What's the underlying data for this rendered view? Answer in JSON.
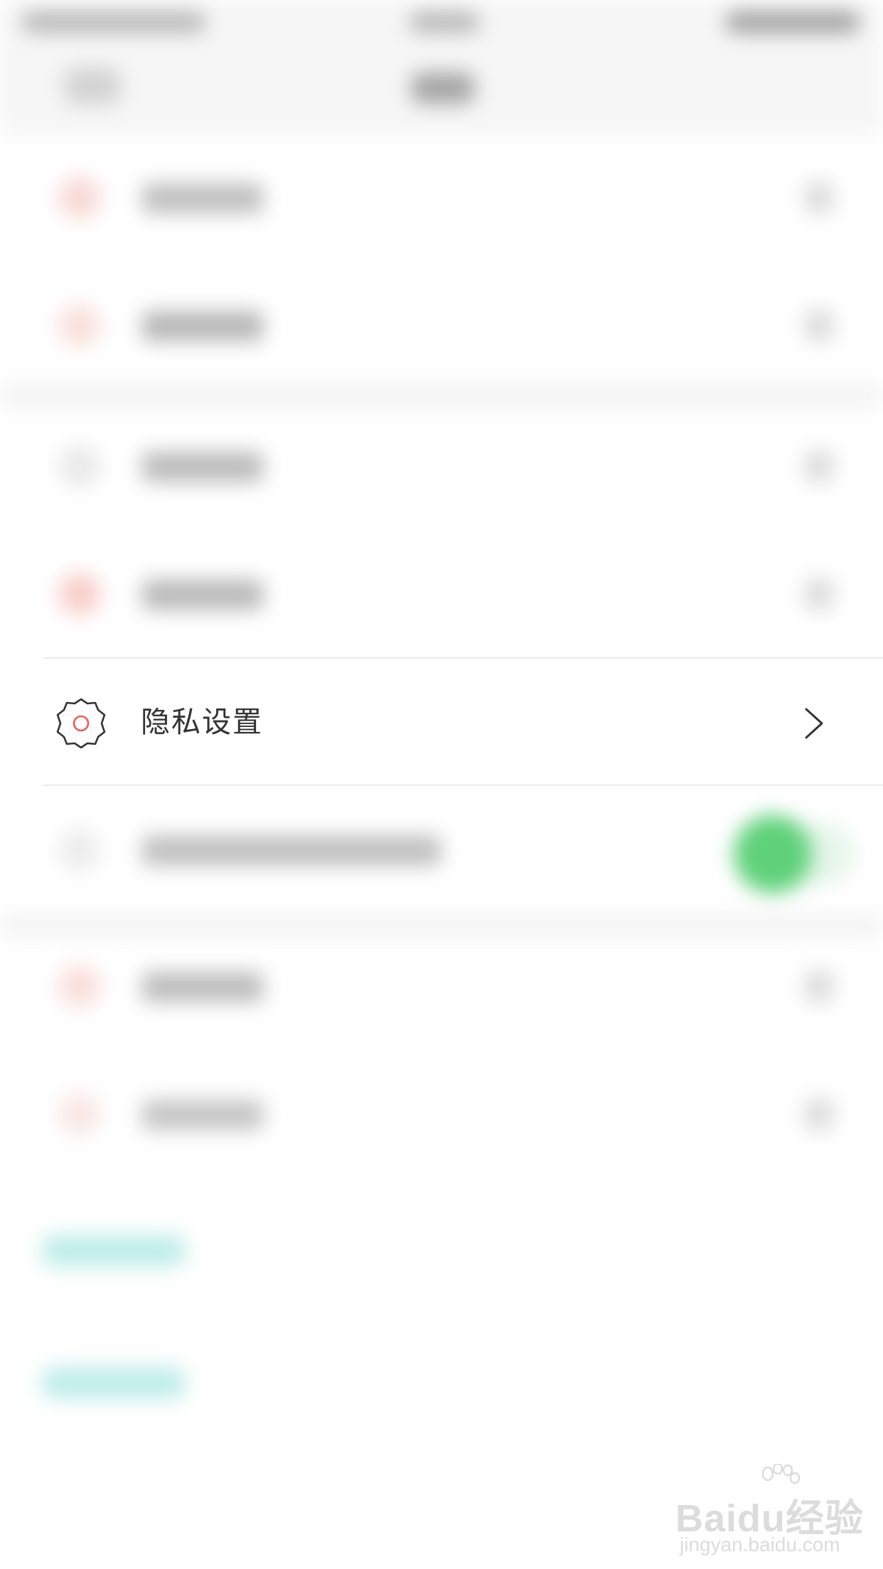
{
  "privacy_settings": {
    "label": "隐私设置",
    "icon": "gear-icon",
    "chevron_icon": "chevron-right-icon",
    "icon_accent_color": "#f05a5a",
    "icon_stroke_color": "#333333"
  },
  "watermark": {
    "brand": "Baidu经验",
    "url": "jingyan.baidu.com"
  },
  "colors": {
    "toggle_on": "#5fd17a",
    "background": "#ffffff",
    "section_gap": "#f4f4f4"
  }
}
